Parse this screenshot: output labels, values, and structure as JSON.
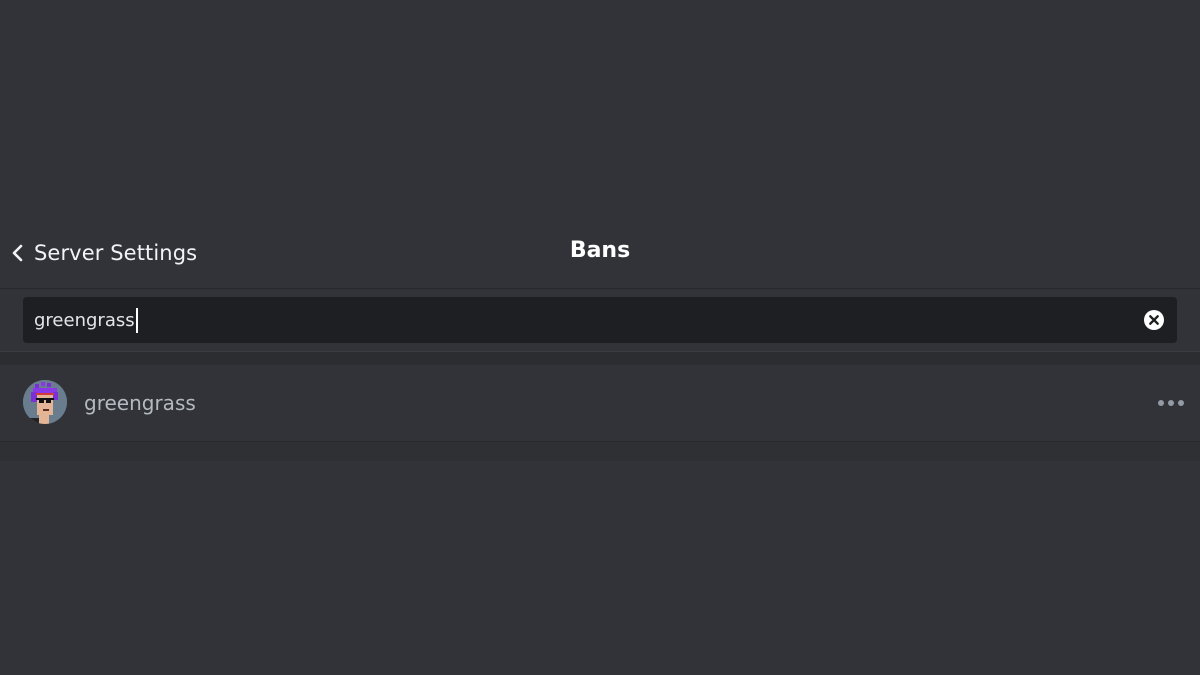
{
  "header": {
    "back_label": "Server Settings",
    "title": "Bans"
  },
  "search": {
    "value": "greengrass",
    "clear_icon": "clear-circle-x-icon"
  },
  "bans": [
    {
      "username": "greengrass",
      "avatar": "pixel-punk-avatar",
      "more_icon": "more-dots-icon"
    }
  ],
  "colors": {
    "background": "#313338",
    "input_background": "#1e1f22",
    "muted_text": "#b5bac1",
    "header_text": "#ffffff"
  }
}
